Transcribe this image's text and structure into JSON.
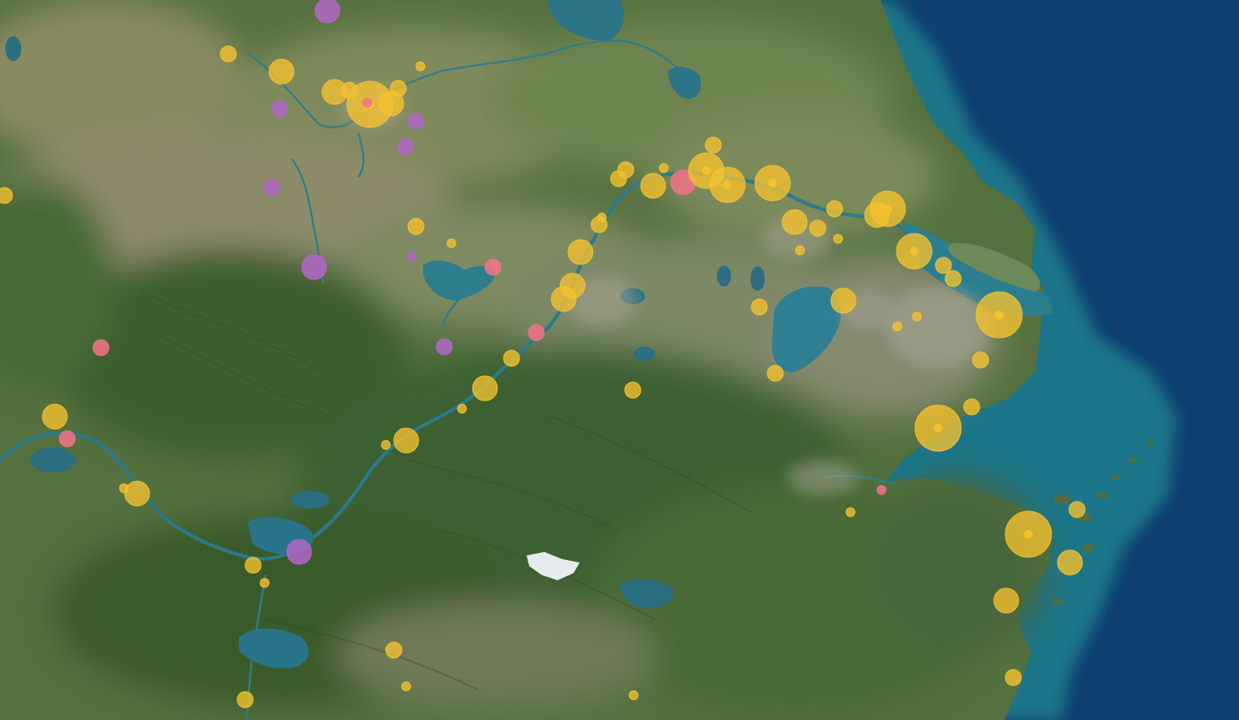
{
  "map": {
    "kind": "satellite",
    "colors": {
      "ocean": "#0d3e6e",
      "shelf": "#1f7f8a",
      "land_green": "#4d6e38",
      "land_dark": "#3a5a2c",
      "land_tan": "#8a8464",
      "water": "#2c6f82",
      "urban": "#9a9a88"
    },
    "marker_colors": {
      "yellow": "#f5c12e",
      "pink": "#f3728a",
      "purple": "#b067c6"
    },
    "marker_categories": [
      "yellow",
      "pink",
      "purple"
    ],
    "markers": [
      {
        "id": "m01",
        "cat": "purple",
        "size": 3
      },
      {
        "id": "m02",
        "cat": "yellow",
        "size": 2
      },
      {
        "id": "m03",
        "cat": "yellow",
        "size": 3
      },
      {
        "id": "m04",
        "cat": "yellow",
        "size": 1
      },
      {
        "id": "m05",
        "cat": "yellow",
        "size": 3
      },
      {
        "id": "m06",
        "cat": "yellow",
        "size": 5
      },
      {
        "id": "m07",
        "cat": "yellow",
        "size": 3
      },
      {
        "id": "m08",
        "cat": "yellow",
        "size": 2
      },
      {
        "id": "m09",
        "cat": "yellow",
        "size": 2
      },
      {
        "id": "m10",
        "cat": "pink",
        "size": 1
      },
      {
        "id": "m11",
        "cat": "purple",
        "size": 2
      },
      {
        "id": "m12",
        "cat": "purple",
        "size": 2
      },
      {
        "id": "m13",
        "cat": "purple",
        "size": 2
      },
      {
        "id": "m14",
        "cat": "purple",
        "size": 2
      },
      {
        "id": "m15",
        "cat": "yellow",
        "size": 2
      },
      {
        "id": "m16",
        "cat": "yellow",
        "size": 2
      },
      {
        "id": "m17",
        "cat": "yellow",
        "size": 1
      },
      {
        "id": "m18",
        "cat": "purple",
        "size": 3
      },
      {
        "id": "m19",
        "cat": "purple",
        "size": 1
      },
      {
        "id": "m20",
        "cat": "pink",
        "size": 2
      },
      {
        "id": "m21",
        "cat": "pink",
        "size": 2
      },
      {
        "id": "m22",
        "cat": "purple",
        "size": 2
      },
      {
        "id": "m23",
        "cat": "pink",
        "size": 2
      },
      {
        "id": "m24",
        "cat": "yellow",
        "size": 2
      },
      {
        "id": "m25",
        "cat": "yellow",
        "size": 3
      },
      {
        "id": "m26",
        "cat": "yellow",
        "size": 1
      },
      {
        "id": "m27",
        "cat": "yellow",
        "size": 3
      },
      {
        "id": "m28",
        "cat": "yellow",
        "size": 1
      },
      {
        "id": "m29",
        "cat": "yellow",
        "size": 3
      },
      {
        "id": "m30",
        "cat": "pink",
        "size": 2
      },
      {
        "id": "m31",
        "cat": "yellow",
        "size": 3
      },
      {
        "id": "m32",
        "cat": "yellow",
        "size": 1
      },
      {
        "id": "m33",
        "cat": "yellow",
        "size": 2
      },
      {
        "id": "m34",
        "cat": "purple",
        "size": 3
      },
      {
        "id": "m35",
        "cat": "yellow",
        "size": 1
      },
      {
        "id": "m36",
        "cat": "yellow",
        "size": 2
      },
      {
        "id": "m37",
        "cat": "yellow",
        "size": 2
      },
      {
        "id": "m38",
        "cat": "yellow",
        "size": 1
      },
      {
        "id": "m39",
        "cat": "yellow",
        "size": 2
      },
      {
        "id": "m40",
        "cat": "yellow",
        "size": 2
      },
      {
        "id": "m41",
        "cat": "yellow",
        "size": 2
      },
      {
        "id": "m42",
        "cat": "pink",
        "size": 3
      },
      {
        "id": "m43",
        "cat": "yellow",
        "size": 3
      },
      {
        "id": "m44",
        "cat": "yellow",
        "size": 4
      },
      {
        "id": "m45",
        "cat": "yellow",
        "size": 1
      },
      {
        "id": "m46",
        "cat": "yellow",
        "size": 4
      },
      {
        "id": "m47",
        "cat": "yellow",
        "size": 4
      },
      {
        "id": "m48",
        "cat": "yellow",
        "size": 2
      },
      {
        "id": "m49",
        "cat": "yellow",
        "size": 1
      },
      {
        "id": "m50",
        "cat": "yellow",
        "size": 3
      },
      {
        "id": "m51",
        "cat": "yellow",
        "size": 3
      },
      {
        "id": "m52",
        "cat": "yellow",
        "size": 3
      },
      {
        "id": "m53",
        "cat": "yellow",
        "size": 3
      },
      {
        "id": "m54",
        "cat": "yellow",
        "size": 4
      },
      {
        "id": "m55",
        "cat": "yellow",
        "size": 3
      },
      {
        "id": "m56",
        "cat": "yellow",
        "size": 4
      },
      {
        "id": "m57",
        "cat": "yellow",
        "size": 2
      },
      {
        "id": "m58",
        "cat": "yellow",
        "size": 3
      },
      {
        "id": "m59",
        "cat": "yellow",
        "size": 2
      },
      {
        "id": "m60",
        "cat": "yellow",
        "size": 2
      },
      {
        "id": "m61",
        "cat": "yellow",
        "size": 1
      },
      {
        "id": "m62",
        "cat": "yellow",
        "size": 1
      },
      {
        "id": "m63",
        "cat": "yellow",
        "size": 2
      },
      {
        "id": "m64",
        "cat": "yellow",
        "size": 1
      },
      {
        "id": "m65",
        "cat": "yellow",
        "size": 2
      },
      {
        "id": "m66",
        "cat": "yellow",
        "size": 5
      },
      {
        "id": "m67",
        "cat": "yellow",
        "size": 2
      },
      {
        "id": "m68",
        "cat": "yellow",
        "size": 1
      },
      {
        "id": "m69",
        "cat": "pink",
        "size": 1
      },
      {
        "id": "m70",
        "cat": "yellow",
        "size": 1
      },
      {
        "id": "m71",
        "cat": "yellow",
        "size": 2
      },
      {
        "id": "m72",
        "cat": "yellow",
        "size": 5
      },
      {
        "id": "m73",
        "cat": "yellow",
        "size": 2
      },
      {
        "id": "m74",
        "cat": "yellow",
        "size": 5
      },
      {
        "id": "m75",
        "cat": "yellow",
        "size": 3
      },
      {
        "id": "m76",
        "cat": "yellow",
        "size": 2
      },
      {
        "id": "m77",
        "cat": "yellow",
        "size": 3
      },
      {
        "id": "m78",
        "cat": "yellow",
        "size": 2
      },
      {
        "id": "m79",
        "cat": "yellow",
        "size": 1
      },
      {
        "id": "m80",
        "cat": "yellow",
        "size": 2
      }
    ]
  }
}
